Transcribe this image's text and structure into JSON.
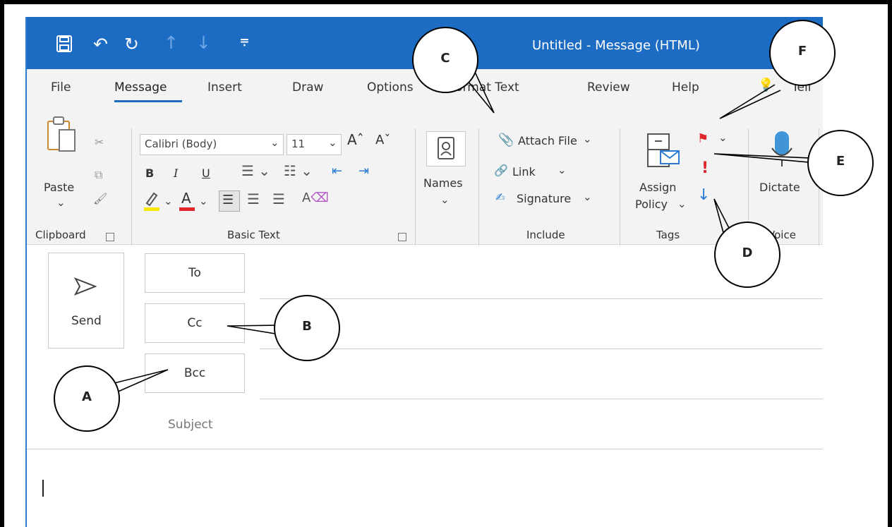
{
  "window": {
    "title": "Untitled - Message (HTML)"
  },
  "menu": {
    "tabs": [
      "File",
      "Message",
      "Insert",
      "Draw",
      "Options",
      "Format Text",
      "Review",
      "Help",
      "Tell"
    ],
    "active": "Message"
  },
  "ribbon": {
    "clipboard": {
      "paste": "Paste",
      "group": "Clipboard"
    },
    "basic_text": {
      "font": "Calibri (Body)",
      "size": "11",
      "bold": "B",
      "italic": "I",
      "underline": "U",
      "group": "Basic Text"
    },
    "names": {
      "label": "Names"
    },
    "include": {
      "attach": "Attach File",
      "link": "Link",
      "signature": "Signature",
      "group": "Include"
    },
    "tags": {
      "assign_1": "Assign",
      "assign_2": "Policy",
      "group": "Tags"
    },
    "voice": {
      "dictate": "Dictate",
      "group": "Voice"
    }
  },
  "compose": {
    "send": "Send",
    "to": "To",
    "cc": "Cc",
    "bcc": "Bcc",
    "subject": "Subject"
  },
  "callouts": {
    "a": "A",
    "b": "B",
    "c": "C",
    "d": "D",
    "e": "E",
    "f": "F"
  },
  "colors": {
    "titlebar": "#1d6cc4",
    "flag": "#e0262b",
    "importance_high": "#e0262b",
    "importance_low": "#2b7bd3"
  }
}
